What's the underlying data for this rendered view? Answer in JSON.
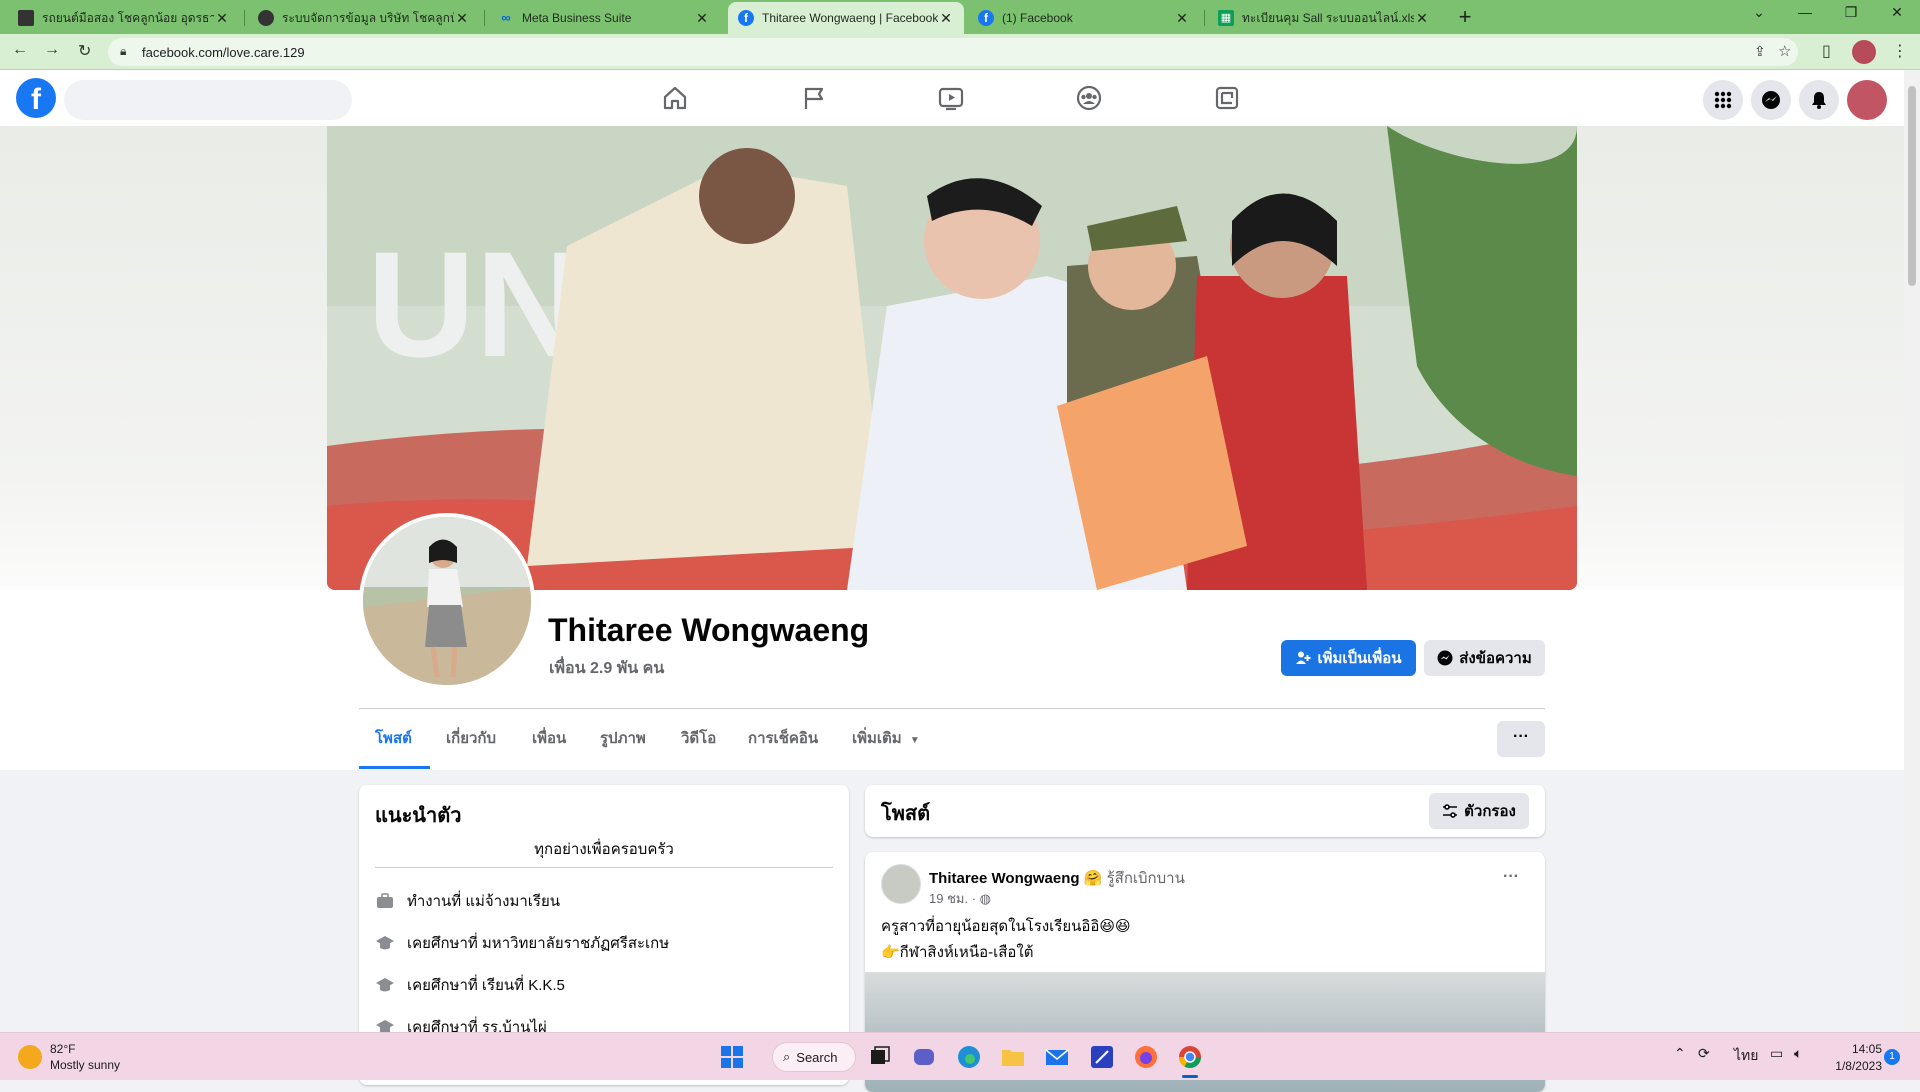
{
  "browser": {
    "tabs": [
      {
        "title": "รถยนต์มือสอง โชคลูกน้อย อุดรธานี",
        "icon": "site-favicon"
      },
      {
        "title": "ระบบจัดการข้อมูล บริษัท โชคลูกน้อย",
        "icon": "globe-icon"
      },
      {
        "title": "Meta Business Suite",
        "icon": "meta-icon"
      },
      {
        "title": "Thitaree Wongwaeng | Facebook",
        "icon": "facebook-icon"
      },
      {
        "title": "(1) Facebook",
        "icon": "facebook-icon"
      },
      {
        "title": "ทะเบียนคุม Sall ระบบออนไลน์.xlsx - G",
        "icon": "sheets-icon"
      }
    ],
    "active_tab": 3,
    "url": "facebook.com/love.care.129"
  },
  "fb": {
    "search_placeholder": "",
    "nav_icons": [
      "home-icon",
      "pages-flag-icon",
      "watch-video-icon",
      "groups-icon",
      "gaming-icon"
    ],
    "right_icons": [
      "menu-grid-icon",
      "messenger-icon",
      "notifications-bell-icon",
      "account-avatar"
    ]
  },
  "profile": {
    "name": "Thitaree Wongwaeng",
    "friends": "เพื่อน 2.9 พัน คน",
    "add_friend_label": "เพิ่มเป็นเพื่อน",
    "message_label": "ส่งข้อความ",
    "tabs": [
      "โพสต์",
      "เกี่ยวกับ",
      "เพื่อน",
      "รูปภาพ",
      "วิดีโอ",
      "การเช็คอิน",
      "เพิ่มเติม"
    ],
    "more_label": "···"
  },
  "intro": {
    "title": "แนะนำตัว",
    "bio": "ทุกอย่างเพื่อครอบครัว",
    "items": [
      {
        "icon": "briefcase-icon",
        "text": "ทำงานที่ แม่จ้างมาเรียน"
      },
      {
        "icon": "graduation-cap-icon",
        "text": "เคยศึกษาที่ มหาวิทยาลัยราชภัฏศรีสะเกษ"
      },
      {
        "icon": "graduation-cap-icon",
        "text": "เคยศึกษาที่ เรียนที่ K.K.5"
      },
      {
        "icon": "graduation-cap-icon",
        "text": "เคยศึกษาที่ รร.บ้านไผ่"
      }
    ]
  },
  "posts": {
    "title": "โพสต์",
    "filter_label": "ตัวกรอง",
    "post": {
      "author": "Thitaree Wongwaeng",
      "feeling": "รู้สึกเบิกบาน",
      "meta": "19 ชม. · ",
      "line1": "ครูสาวที่อายุน้อยสุดในโรงเรียนอิอิ😆😆",
      "line2": "👉กีฬาสิงห์เหนือ-เสือใต้",
      "menu": "···"
    }
  },
  "taskbar": {
    "weather_temp": "82°F",
    "weather_desc": "Mostly sunny",
    "search_label": "Search",
    "lang": "ไทย",
    "time": "14:05",
    "date": "1/8/2023",
    "notif_count": "1"
  },
  "colors": {
    "tabstrip": "#7bc16f",
    "fb_blue": "#1877f2",
    "taskbar": "#f2d6e5"
  }
}
